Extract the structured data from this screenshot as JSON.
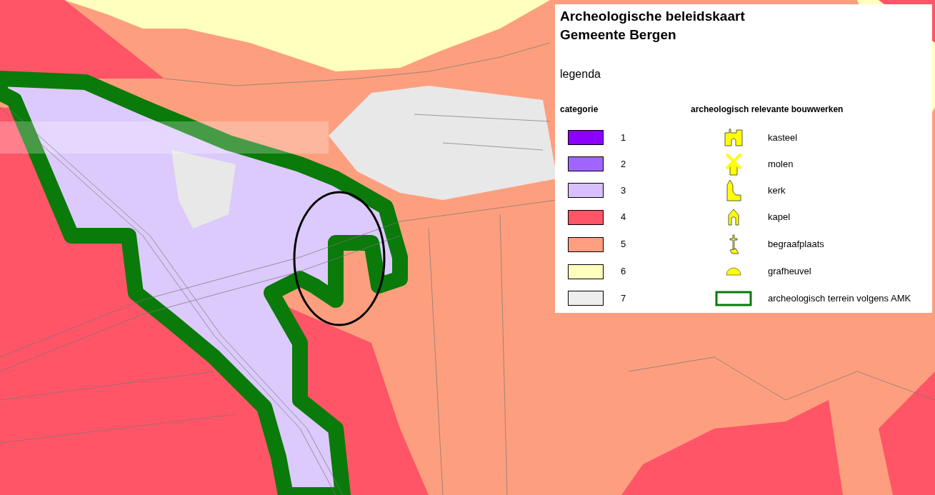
{
  "legend": {
    "title": "Archeologische beleidskaart",
    "subtitle": "Gemeente Bergen",
    "heading": "legenda",
    "categories_heading": "categorie",
    "structures_heading": "archeologisch relevante bouwwerken",
    "categories": [
      {
        "label": "1",
        "color": "#8c00ff"
      },
      {
        "label": "2",
        "color": "#a066ff"
      },
      {
        "label": "3",
        "color": "#d8bfff"
      },
      {
        "label": "4",
        "color": "#ff5567"
      },
      {
        "label": "5",
        "color": "#ff9f7f"
      },
      {
        "label": "6",
        "color": "#ffffbe"
      },
      {
        "label": "7",
        "color": "#eeeeee"
      }
    ],
    "structures": [
      {
        "kind": "castle",
        "label": "kasteel"
      },
      {
        "kind": "mill",
        "label": "molen"
      },
      {
        "kind": "church",
        "label": "kerk"
      },
      {
        "kind": "chapel",
        "label": "kapel"
      },
      {
        "kind": "cemetery",
        "label": "begraafplaats"
      },
      {
        "kind": "mound",
        "label": "grafheuvel"
      },
      {
        "kind": "terrain",
        "label": "archeologisch terrein volgens AMK"
      }
    ]
  }
}
